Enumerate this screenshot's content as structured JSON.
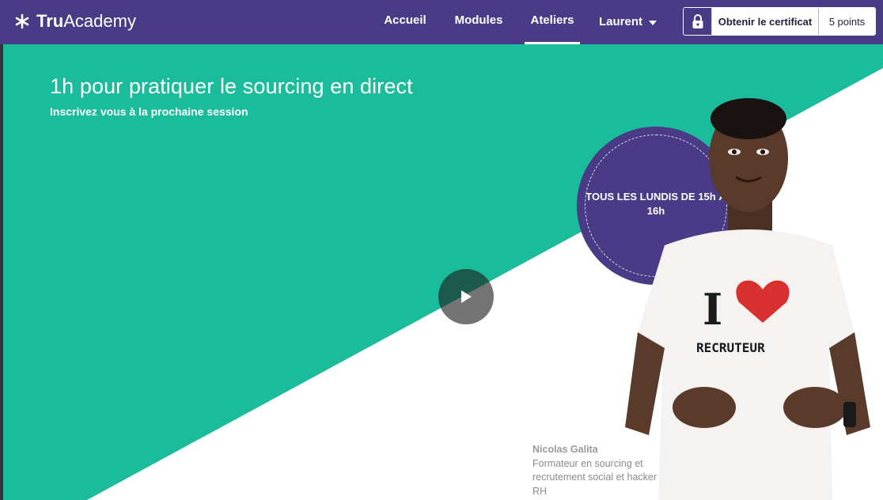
{
  "brand": {
    "name_bold": "Tru",
    "name_regular": "Academy",
    "icon": "asterisk-logo-icon"
  },
  "nav": {
    "items": [
      {
        "label": "Accueil",
        "active": false
      },
      {
        "label": "Modules",
        "active": false
      },
      {
        "label": "Ateliers",
        "active": true
      }
    ],
    "user": {
      "label": "Laurent",
      "icon": "caret-down-icon"
    }
  },
  "certificate": {
    "lock_icon": "lock-icon",
    "button_label": "Obtenir le certificat",
    "points_label": "5 points"
  },
  "hero": {
    "title": "1h pour pratiquer le sourcing en direct",
    "subtitle": "Inscrivez vous à la prochaine session",
    "schedule": "TOUS LES LUNDIS DE 15h À 16h",
    "video_play_icon": "play-icon",
    "shirt_text_i": "I",
    "shirt_text_word": "RECRUTEUR"
  },
  "speaker": {
    "name": "Nicolas Galita",
    "role": "Formateur en sourcing et recrutement social et hacker RH"
  },
  "colors": {
    "nav_bg": "#4a3b86",
    "hero_green": "#1bbc9b",
    "badge_purple": "#4a3b86"
  }
}
